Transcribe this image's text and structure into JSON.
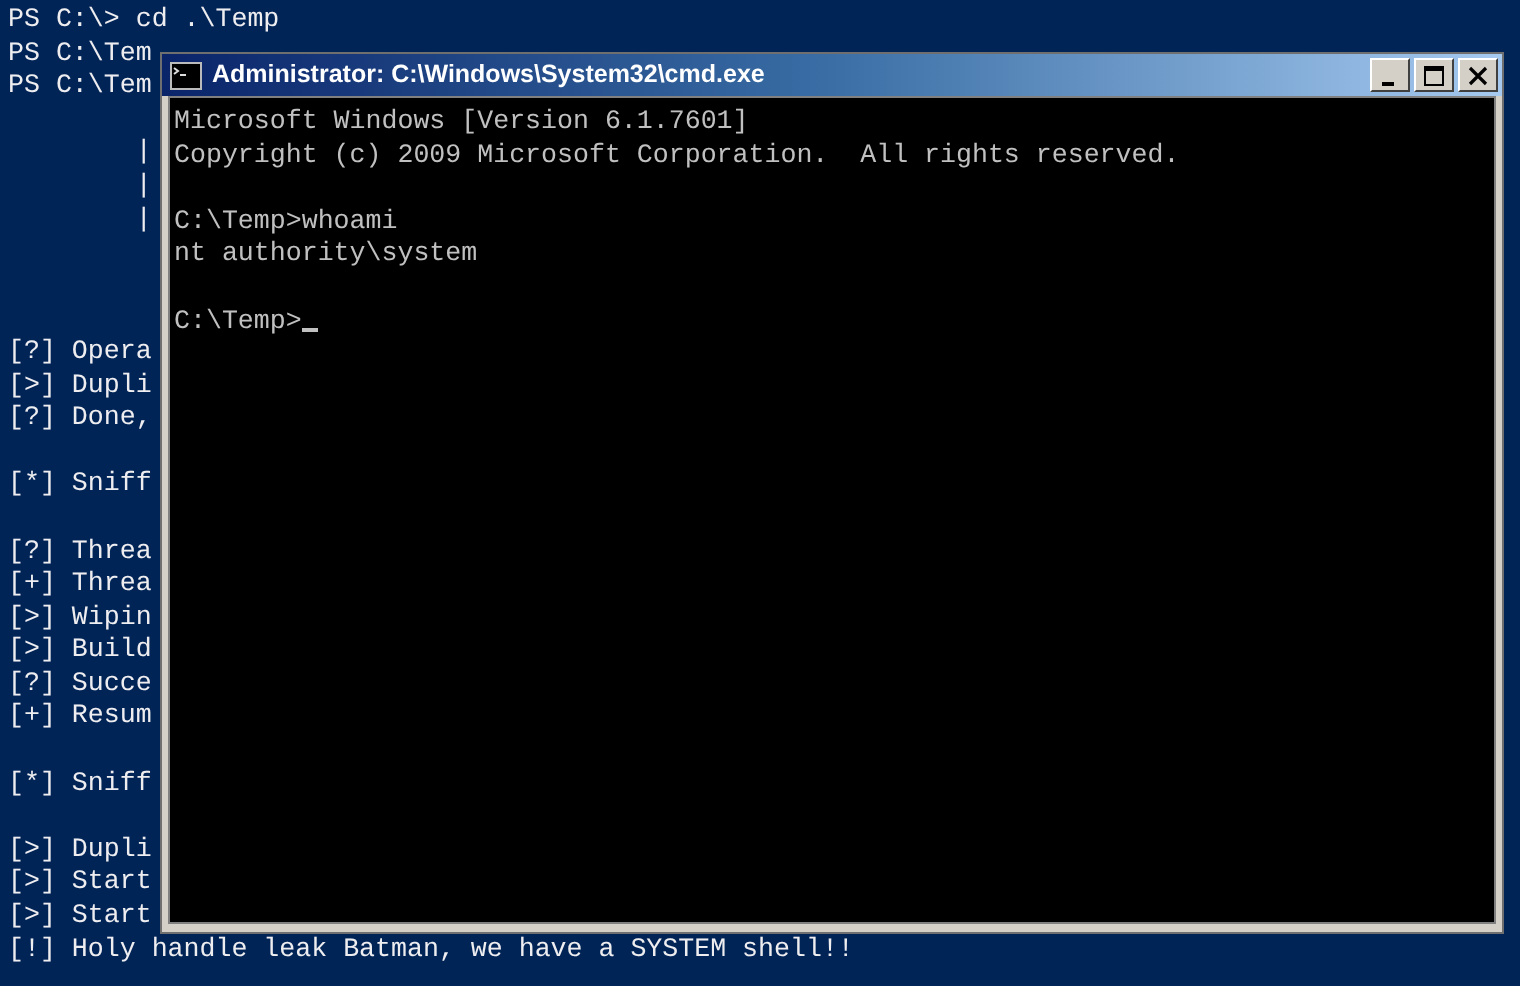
{
  "powershell": {
    "blocks": [
      {
        "kind": "text",
        "lines": [
          "PS C:\\> cd .\\Temp",
          "PS C:\\Tem",
          "PS C:\\Tem"
        ]
      },
      {
        "kind": "banner",
        "lines": [
          "|",
          "|",
          "|"
        ]
      },
      {
        "kind": "text",
        "lines": [
          "[?] Opera",
          "[>] Dupli",
          "[?] Done,"
        ]
      },
      {
        "kind": "text",
        "lines": [
          "[*] Sniff"
        ]
      },
      {
        "kind": "text",
        "lines": [
          "[?] Threa",
          "[+] Threa",
          "[>] Wipin",
          "[>] Build",
          "[?] Succe",
          "[+] Resum"
        ]
      },
      {
        "kind": "text",
        "lines": [
          "[*] Sniff"
        ]
      },
      {
        "kind": "text",
        "lines": [
          "[>] Dupli",
          "[>] Start",
          "[>] Start",
          "[!] Holy handle leak Batman, we have a SYSTEM shell!!"
        ]
      }
    ]
  },
  "window": {
    "title": "Administrator: C:\\Windows\\System32\\cmd.exe",
    "blocks": [
      {
        "lines": [
          "Microsoft Windows [Version 6.1.7601]",
          "Copyright (c) 2009 Microsoft Corporation.  All rights reserved."
        ]
      },
      {
        "lines": [
          "C:\\Temp>whoami",
          "nt authority\\system"
        ]
      }
    ],
    "prompt": "C:\\Temp>"
  }
}
